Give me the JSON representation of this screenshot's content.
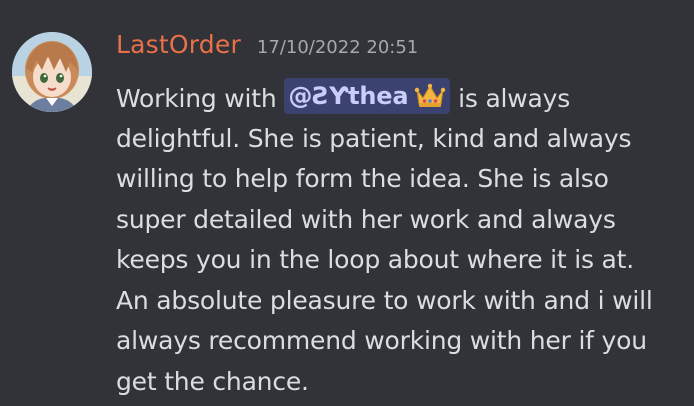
{
  "message": {
    "author": "LastOrder",
    "timestamp": "17/10/2022 20:51",
    "text_before_mention": "Working with ",
    "mention": {
      "handle": "@ƧƳthea",
      "emoji": "crown-icon",
      "color": "#c9cdfb",
      "background": "#3c4270"
    },
    "text_after_mention": " is always",
    "lines": [
      "delightful. She is patient, kind and always",
      "willing to help form the idea. She is also",
      "super detailed with her work and always",
      "keeps you in the loop about where it is at.",
      "An absolute pleasure to work with and i will",
      "always recommend working with her if you",
      "get the chance."
    ]
  },
  "colors": {
    "background": "#313338",
    "username": "#e8714a",
    "timestamp": "#a6a8ad",
    "text": "#dbdee1"
  }
}
